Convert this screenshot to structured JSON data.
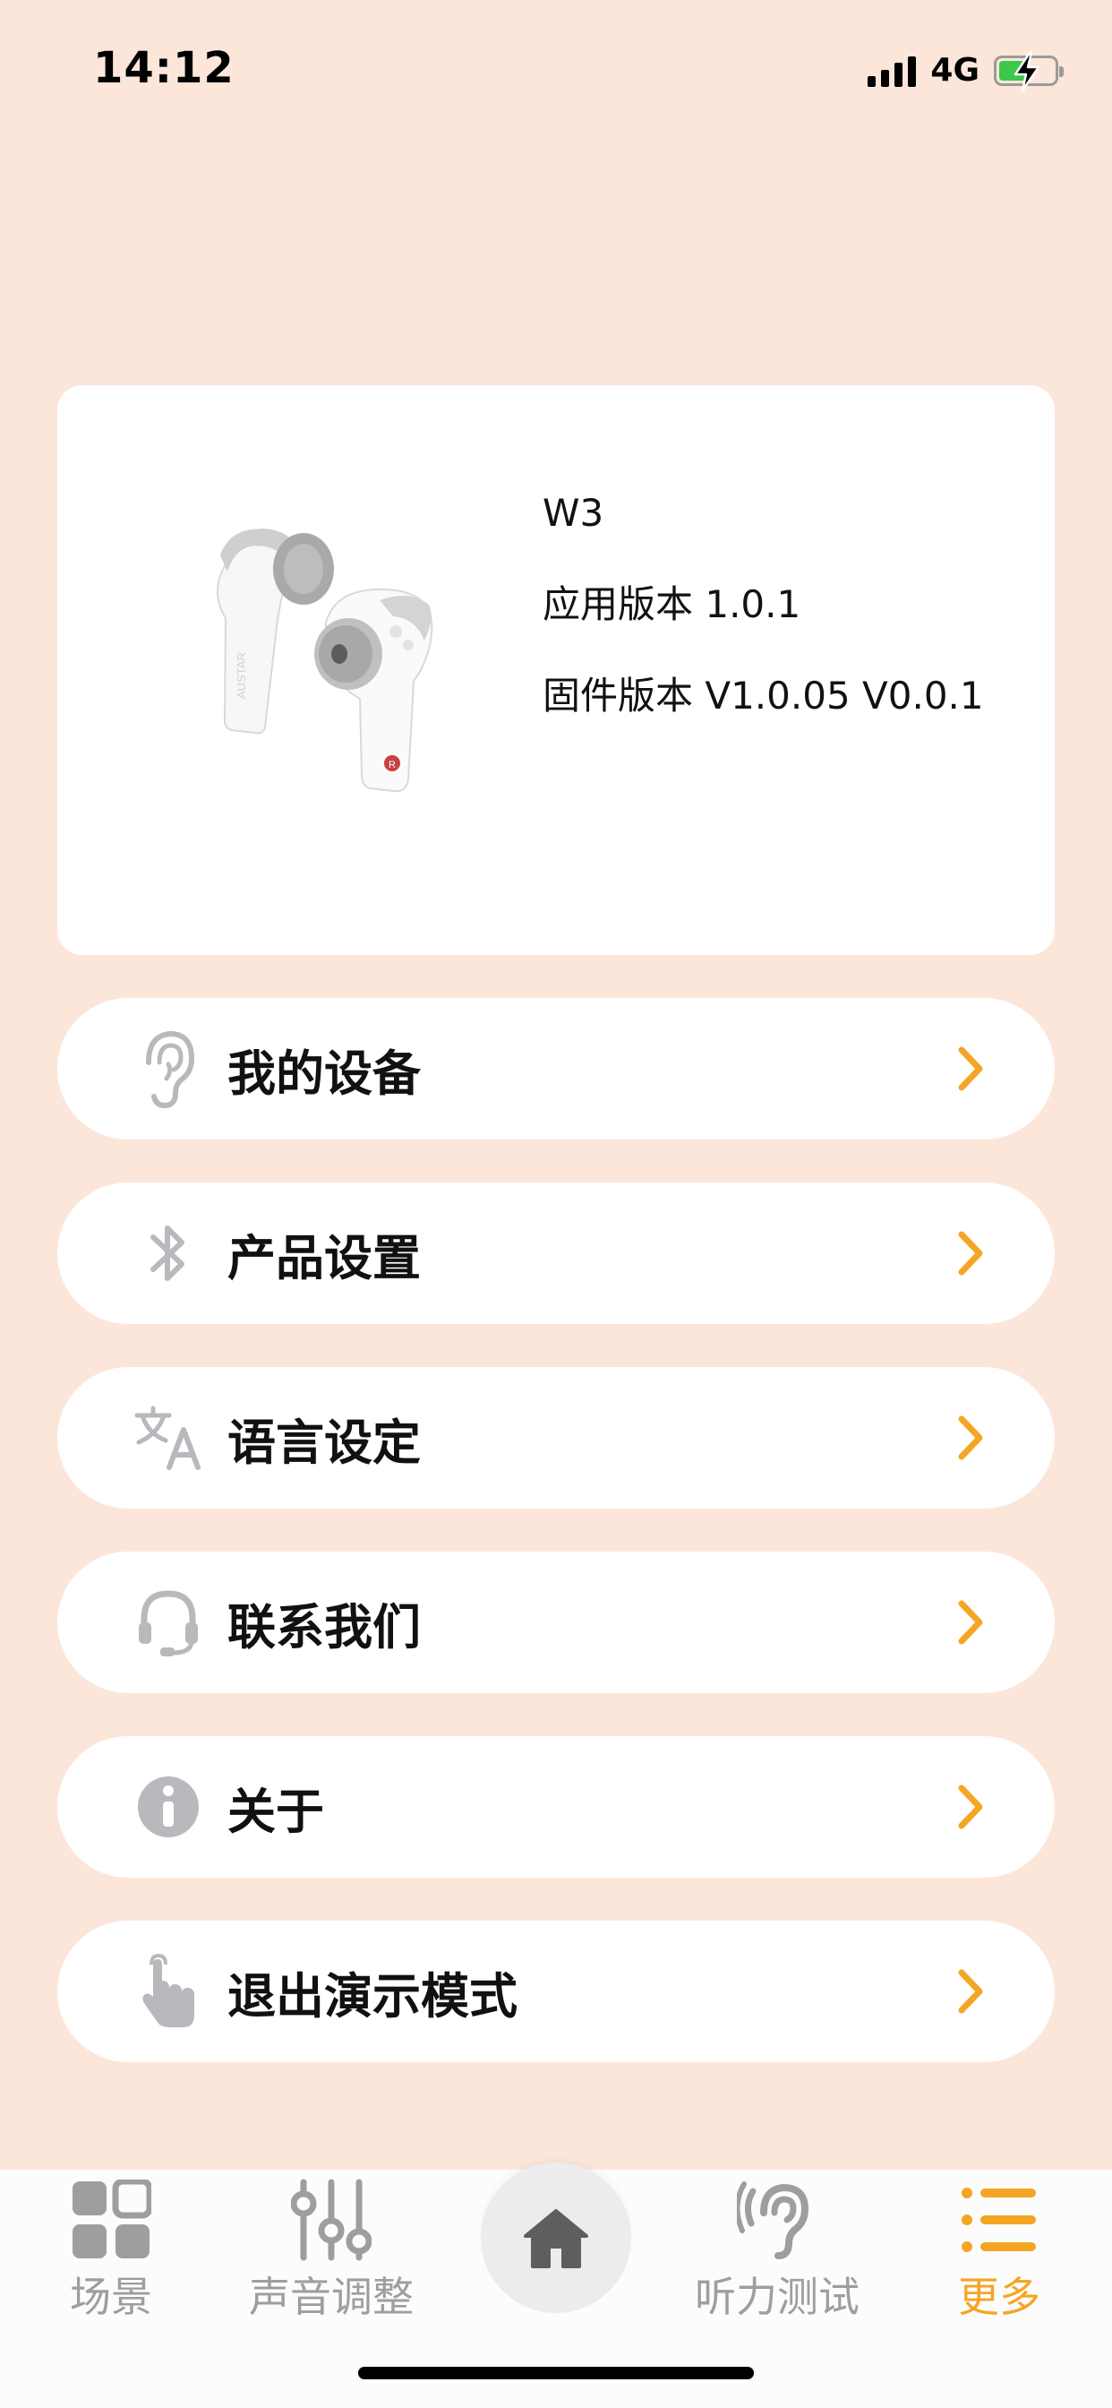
{
  "status_bar": {
    "time": "14:12",
    "network": "4G",
    "battery_level": 0.5,
    "icons": [
      "signal-icon",
      "battery-charging-icon"
    ]
  },
  "device": {
    "name": "W3",
    "app_version": "应用版本 1.0.1",
    "firmware_version": "固件版本 V1.0.05 V0.0.1",
    "image": "earbuds-image"
  },
  "menu": {
    "items": [
      {
        "label": "我的设备",
        "icon": "ear-icon"
      },
      {
        "label": "产品设置",
        "icon": "bluetooth-icon"
      },
      {
        "label": "语言设定",
        "icon": "translate-icon"
      },
      {
        "label": "联系我们",
        "icon": "headset-icon"
      },
      {
        "label": "关于",
        "icon": "info-icon"
      },
      {
        "label": "退出演示模式",
        "icon": "tap-hand-icon"
      }
    ],
    "chevron_color": "#F5A524",
    "icon_color": "#B7B9BC"
  },
  "bottom_nav": {
    "tabs": [
      {
        "label": "场景",
        "icon": "grid-icon",
        "active": false
      },
      {
        "label": "声音调整",
        "icon": "sliders-icon",
        "active": false
      },
      {
        "label": "",
        "icon": "home-icon",
        "active": false
      },
      {
        "label": "听力测试",
        "icon": "hearing-icon",
        "active": false
      },
      {
        "label": "更多",
        "icon": "list-icon",
        "active": true
      }
    ],
    "active_color": "#F5A524",
    "inactive_color": "#9E9E9E"
  },
  "colors": {
    "background": "#FCE6DA",
    "card": "#FFFFFF",
    "accent": "#F5A524"
  }
}
